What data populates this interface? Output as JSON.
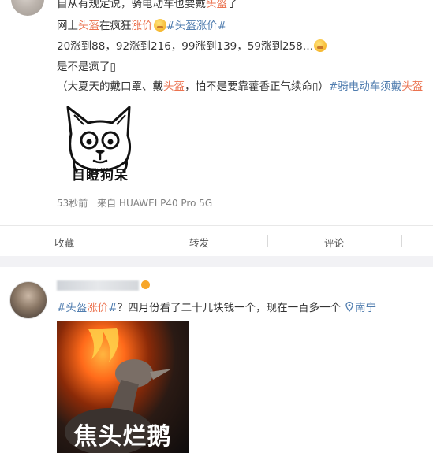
{
  "post1": {
    "line1_a": "自从有规定说，骑电动车也要戴",
    "line1_b": "头盔",
    "line1_c": "了",
    "line2_a": "网上",
    "line2_b": "头盔",
    "line2_c": "在疯狂",
    "line2_d": "涨价",
    "line2_tag": "#头盔涨价#",
    "line3": "20涨到88，92涨到216，99涨到139，59涨到258…",
    "line4": "是不是疯了▯",
    "line5_a": "（大夏天的戴口罩、戴",
    "line5_b": "头盔",
    "line5_c": "，怕不是要靠藿香正气续命▯）",
    "line5_tag1": "#骑电动车须戴",
    "line5_tag2": "头盔",
    "sticker_text": "目瞪狗呆",
    "meta_time": "53秒前",
    "meta_source": "来自 HUAWEI P40 Pro 5G",
    "actions": {
      "collect": "收藏",
      "repost": "转发",
      "comment": "评论"
    }
  },
  "post2": {
    "tag_a": "#头盔",
    "tag_b": "涨价",
    "tag_c": "#",
    "text": "？四月份看了二十几块钱一个，现在一百多一个",
    "location": "南宁",
    "meme_caption": "焦头烂鹅"
  },
  "colors": {
    "keyword_red": "#eb7350",
    "link_blue": "#507daf",
    "meta_gray": "#808080"
  }
}
